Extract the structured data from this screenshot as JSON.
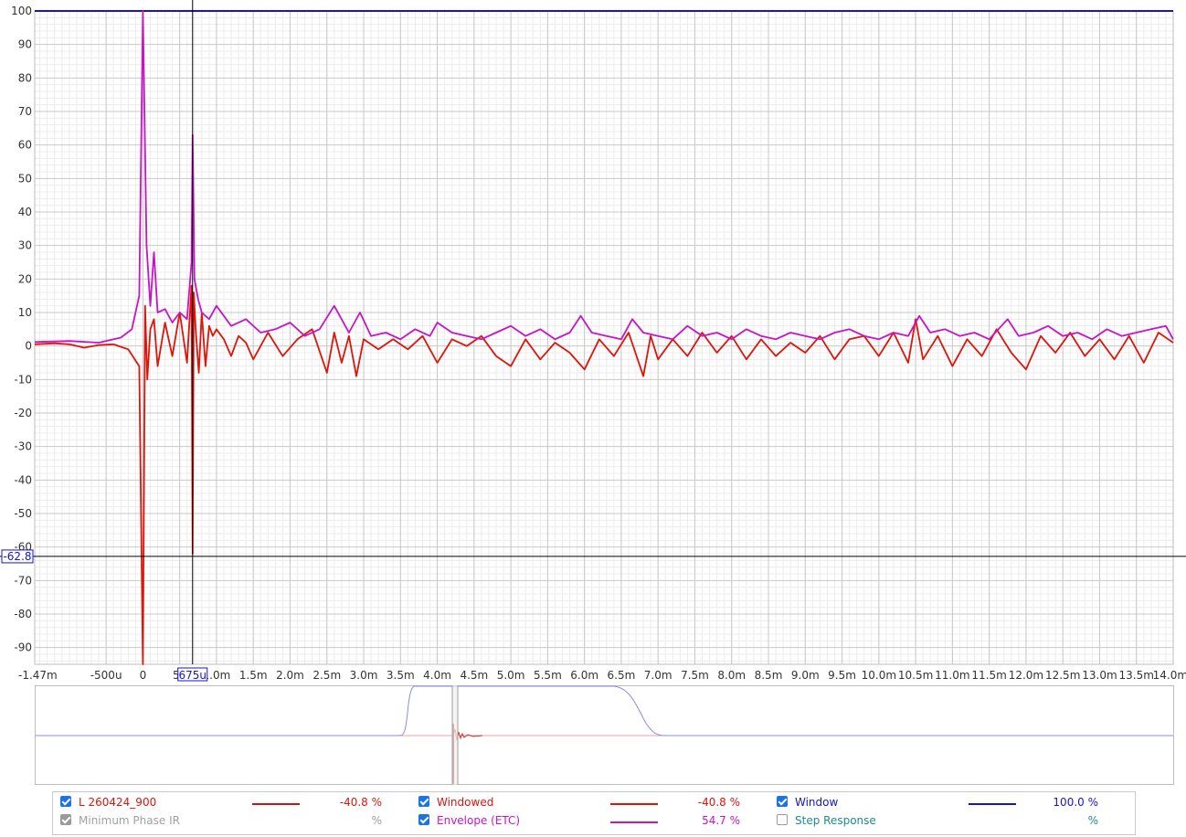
{
  "chart_data": {
    "type": "line",
    "x_unit": "ms",
    "xlim": [
      -1.47,
      14.0
    ],
    "ylim": [
      -95,
      100
    ],
    "y_ticks": [
      100,
      90,
      80,
      70,
      60,
      50,
      40,
      30,
      20,
      10,
      0,
      -10,
      -20,
      -30,
      -40,
      -50,
      -60,
      -70,
      -80,
      -90
    ],
    "x_ticks": [
      {
        "v": -1.47,
        "label": "-1.47m"
      },
      {
        "v": -0.5,
        "label": "-500u"
      },
      {
        "v": 0,
        "label": "0"
      },
      {
        "v": 0.5,
        "label": "50"
      },
      {
        "v": 1.0,
        "label": "1.0m"
      },
      {
        "v": 1.5,
        "label": "1.5m"
      },
      {
        "v": 2.0,
        "label": "2.0m"
      },
      {
        "v": 2.5,
        "label": "2.5m"
      },
      {
        "v": 3.0,
        "label": "3.0m"
      },
      {
        "v": 3.5,
        "label": "3.5m"
      },
      {
        "v": 4.0,
        "label": "4.0m"
      },
      {
        "v": 4.5,
        "label": "4.5m"
      },
      {
        "v": 5.0,
        "label": "5.0m"
      },
      {
        "v": 5.5,
        "label": "5.5m"
      },
      {
        "v": 6.0,
        "label": "6.0m"
      },
      {
        "v": 6.5,
        "label": "6.5m"
      },
      {
        "v": 7.0,
        "label": "7.0m"
      },
      {
        "v": 7.5,
        "label": "7.5m"
      },
      {
        "v": 8.0,
        "label": "8.0m"
      },
      {
        "v": 8.5,
        "label": "8.5m"
      },
      {
        "v": 9.0,
        "label": "9.0m"
      },
      {
        "v": 9.5,
        "label": "9.5m"
      },
      {
        "v": 10.0,
        "label": "10.0m"
      },
      {
        "v": 10.5,
        "label": "10.5m"
      },
      {
        "v": 11.0,
        "label": "11.0m"
      },
      {
        "v": 11.5,
        "label": "11.5m"
      },
      {
        "v": 12.0,
        "label": "12.0m"
      },
      {
        "v": 12.5,
        "label": "12.5m"
      },
      {
        "v": 13.0,
        "label": "13.0m"
      },
      {
        "v": 13.5,
        "label": "13.5m"
      },
      {
        "v": 14.0,
        "label": "14.0ms"
      }
    ],
    "cursor": {
      "x": 0.675,
      "y": -62.8,
      "x_label": "675u",
      "y_label": "-62.8"
    },
    "grid": true,
    "series": [
      {
        "name": "Window",
        "color": "#1414d2",
        "x": [
          -1.47,
          14.0
        ],
        "y": [
          100,
          100
        ]
      },
      {
        "name": "L 260424_900",
        "color": "#e0140a",
        "x": [
          -1.47,
          -1.2,
          -1.0,
          -0.8,
          -0.6,
          -0.4,
          -0.2,
          -0.05,
          0.0,
          0.03,
          0.06,
          0.1,
          0.15,
          0.2,
          0.3,
          0.4,
          0.5,
          0.6,
          0.66,
          0.675,
          0.69,
          0.72,
          0.76,
          0.8,
          0.85,
          0.9,
          0.95,
          1.0,
          1.1,
          1.2,
          1.3,
          1.4,
          1.5,
          1.7,
          1.9,
          2.1,
          2.3,
          2.5,
          2.6,
          2.7,
          2.8,
          2.9,
          3.0,
          3.2,
          3.4,
          3.6,
          3.8,
          4.0,
          4.2,
          4.4,
          4.6,
          4.8,
          5.0,
          5.2,
          5.4,
          5.6,
          5.8,
          6.0,
          6.2,
          6.4,
          6.6,
          6.8,
          6.9,
          7.0,
          7.2,
          7.4,
          7.6,
          7.8,
          8.0,
          8.2,
          8.4,
          8.6,
          8.8,
          9.0,
          9.2,
          9.4,
          9.6,
          9.8,
          10.0,
          10.2,
          10.4,
          10.5,
          10.6,
          10.8,
          11.0,
          11.2,
          11.4,
          11.6,
          11.8,
          12.0,
          12.2,
          12.4,
          12.6,
          12.8,
          13.0,
          13.2,
          13.4,
          13.6,
          13.8,
          14.0
        ],
        "y": [
          0.5,
          0.8,
          0.5,
          -0.5,
          0.3,
          0.5,
          -1.0,
          -6.0,
          -95.0,
          12.0,
          -10.0,
          5.0,
          8.0,
          -6.0,
          7.0,
          -3.0,
          10.0,
          -5.0,
          18.0,
          -62.0,
          16.0,
          4.0,
          -8.0,
          10.0,
          -6.0,
          6.0,
          3.0,
          5.0,
          2.0,
          -3.0,
          3.0,
          1.0,
          -4.0,
          4.0,
          -3.0,
          2.0,
          5.0,
          -8.0,
          4.0,
          -5.0,
          3.0,
          -9.0,
          2.0,
          -1.0,
          2.0,
          -1.0,
          3.0,
          -5.0,
          2.0,
          0.0,
          3.0,
          -3.0,
          -6.0,
          2.0,
          -4.0,
          1.0,
          -2.0,
          -7.0,
          2.0,
          -3.0,
          4.0,
          -9.0,
          3.0,
          -4.0,
          2.0,
          -3.0,
          4.0,
          -2.0,
          3.0,
          -4.0,
          2.0,
          -3.0,
          1.0,
          -2.0,
          3.0,
          -4.0,
          2.0,
          3.0,
          -3.0,
          4.0,
          -5.0,
          8.0,
          -4.0,
          3.0,
          -6.0,
          2.0,
          -3.0,
          5.0,
          -2.0,
          -7.0,
          3.0,
          -2.0,
          4.0,
          -3.0,
          2.0,
          -4.0,
          3.0,
          -5.0,
          4.0,
          1.0
        ]
      },
      {
        "name": "Envelope (ETC)",
        "color": "#c814c8",
        "x": [
          -1.47,
          -1.0,
          -0.6,
          -0.3,
          -0.15,
          -0.05,
          0.0,
          0.05,
          0.1,
          0.15,
          0.2,
          0.3,
          0.4,
          0.5,
          0.6,
          0.66,
          0.675,
          0.7,
          0.75,
          0.8,
          0.9,
          1.0,
          1.2,
          1.4,
          1.6,
          1.8,
          2.0,
          2.2,
          2.4,
          2.6,
          2.8,
          2.95,
          3.1,
          3.3,
          3.5,
          3.7,
          3.9,
          4.0,
          4.2,
          4.4,
          4.6,
          4.8,
          5.0,
          5.2,
          5.4,
          5.6,
          5.8,
          5.95,
          6.1,
          6.3,
          6.5,
          6.65,
          6.8,
          7.0,
          7.2,
          7.4,
          7.6,
          7.8,
          8.0,
          8.2,
          8.4,
          8.6,
          8.8,
          9.0,
          9.2,
          9.4,
          9.6,
          9.8,
          10.0,
          10.2,
          10.4,
          10.55,
          10.7,
          10.9,
          11.1,
          11.3,
          11.5,
          11.75,
          11.9,
          12.1,
          12.3,
          12.5,
          12.7,
          12.9,
          13.1,
          13.3,
          13.5,
          13.7,
          13.9,
          14.0
        ],
        "y": [
          1.2,
          1.5,
          1.0,
          2.5,
          5.0,
          15.0,
          100.0,
          30.0,
          12.0,
          28.0,
          10.0,
          11.0,
          7.0,
          10.0,
          8.0,
          25.0,
          63.0,
          20.0,
          14.0,
          10.0,
          8.0,
          12.0,
          6.0,
          8.0,
          4.0,
          5.0,
          7.0,
          3.0,
          5.0,
          12.0,
          4.0,
          10.0,
          3.0,
          4.0,
          2.0,
          5.0,
          3.0,
          7.0,
          4.0,
          3.0,
          2.0,
          4.0,
          6.0,
          3.0,
          5.0,
          2.0,
          4.0,
          9.0,
          4.0,
          3.0,
          2.0,
          8.0,
          4.0,
          3.0,
          2.0,
          6.0,
          3.0,
          4.0,
          2.0,
          5.0,
          3.0,
          2.0,
          4.0,
          3.0,
          2.0,
          4.0,
          5.0,
          3.0,
          2.0,
          4.0,
          3.0,
          9.0,
          4.0,
          5.0,
          3.0,
          4.0,
          2.0,
          8.0,
          3.0,
          4.0,
          6.0,
          3.0,
          4.0,
          2.0,
          5.0,
          3.0,
          4.0,
          5.0,
          6.0,
          2.0
        ]
      }
    ]
  },
  "overview": {
    "window_color": "#8a8ae6",
    "ir_color": "#c80000",
    "baseline_color": "#f0a0a0"
  },
  "legend": {
    "rows": [
      [
        {
          "label": "L 260424_900",
          "checked": true,
          "color": "#e0140a",
          "line": "#c81414",
          "value": "-40.8 %"
        },
        {
          "label": "Windowed",
          "checked": true,
          "color": "#e0140a",
          "line": "#e0140a",
          "value": "-40.8 %"
        },
        {
          "label": "Window",
          "checked": true,
          "color": "#1414d2",
          "line": "#1414d2",
          "value": "100.0 %"
        }
      ],
      [
        {
          "label": "Minimum Phase IR",
          "checked": true,
          "gray": true,
          "color": "#a0a0a0",
          "line": null,
          "value": "%"
        },
        {
          "label": "Envelope (ETC)",
          "checked": true,
          "color": "#c814c8",
          "line": "#c814c8",
          "value": "54.7 %"
        },
        {
          "label": "Step Response",
          "checked": false,
          "color": "#1e8c8c",
          "line": null,
          "value": "%"
        }
      ]
    ]
  }
}
